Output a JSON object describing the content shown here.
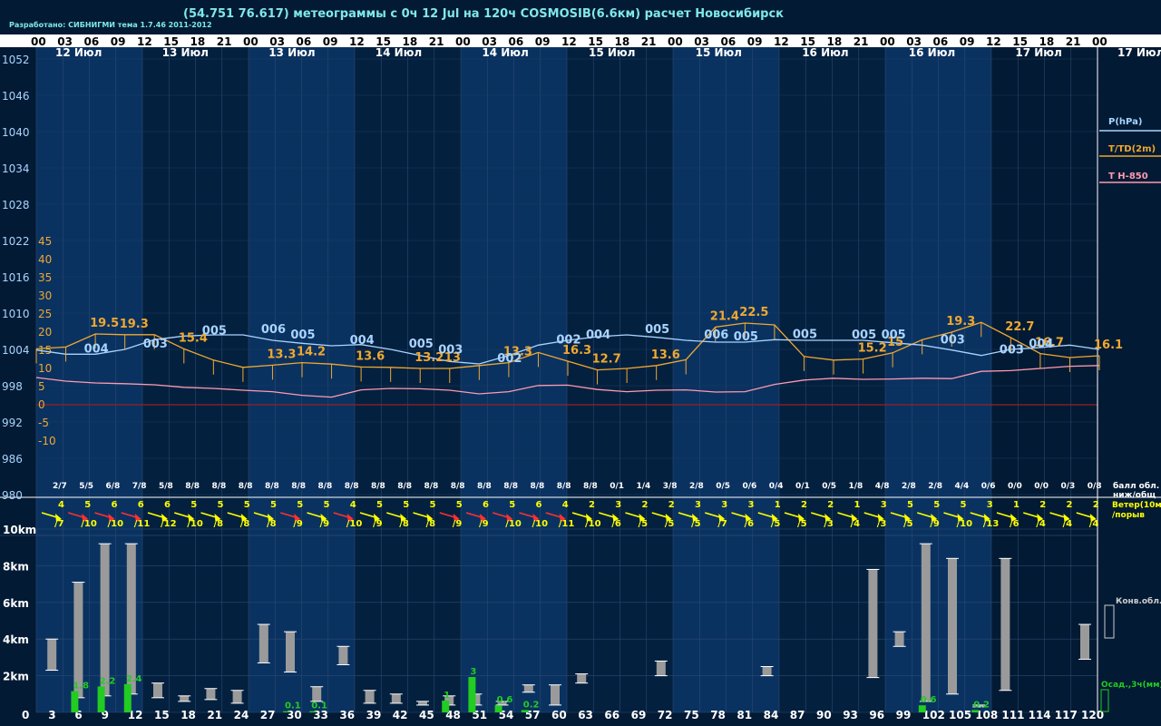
{
  "header": {
    "title": "(54.751 76.617) метеограммы с  0ч 12 Jul на 120ч COSMOSIB(6.6км) расчет Новосибирск",
    "credit": "Разработано: СИБНИГМИ тема 1.7.46 2011-2012"
  },
  "colors": {
    "background": "#021a34",
    "band_light": "#0a3261",
    "band_dark": "#04203f",
    "temperature": "#f0a830",
    "pressure": "#a9d4ff",
    "t850": "#ff9ab0",
    "precip": "#22cc22",
    "cloud_bar": "#9a9a9a",
    "wind_yellow": "#ffff00",
    "wind_red": "#ff3030",
    "zero_line": "#9a2020"
  },
  "chart_data": [
    {
      "type": "line",
      "hour_ticks": [
        "00",
        "03",
        "06",
        "09",
        "12",
        "15",
        "18",
        "21",
        "00",
        "03",
        "06",
        "09",
        "12",
        "15",
        "18",
        "21",
        "00",
        "03",
        "06",
        "09",
        "12",
        "15",
        "18",
        "21",
        "00",
        "03",
        "06",
        "09",
        "12",
        "15",
        "18",
        "21",
        "00",
        "03",
        "06",
        "09",
        "12",
        "15",
        "18",
        "21",
        "00"
      ],
      "day_labels": [
        "12 Июл",
        "13 Июл",
        "13 Июл",
        "14 Июл",
        "14 Июл",
        "15 Июл",
        "15 Июл",
        "16 Июл",
        "16 Июл",
        "17 Июл"
      ],
      "right_day_label": "17 Июл",
      "pressure_axis": [
        1052,
        1046,
        1040,
        1034,
        1028,
        1022,
        1016,
        1010,
        1004,
        998,
        992,
        986,
        980
      ],
      "temp_axis": [
        "45",
        "40",
        "35",
        "30",
        "25",
        "20",
        "15",
        "10",
        "5",
        "0",
        "-5",
        "-10"
      ],
      "legend": [
        "P(hPa)",
        "T/TD(2m)",
        "T H-850"
      ],
      "series": [
        {
          "name": "T/TD(2m)",
          "values": [
            15.4,
            15.9,
            19.5,
            19.3,
            19.3,
            15.4,
            12.3,
            10.3,
            10.9,
            11.6,
            11.2,
            10.4,
            10.3,
            10.0,
            10.0,
            10.8,
            11.6,
            14.4,
            12.0,
            9.6,
            10.0,
            10.8,
            12.4,
            21.4,
            22.5,
            22.0,
            13.3,
            12.3,
            12.6,
            14.3,
            17.9,
            20.0,
            22.7,
            18.5,
            14.1,
            13.0,
            13.5
          ]
        },
        {
          "name": "P(hPa)",
          "values": [
            1003.9,
            1003.2,
            1003.2,
            1004.0,
            1005.6,
            1006.2,
            1006.4,
            1006.4,
            1005.5,
            1005.0,
            1004.6,
            1004.8,
            1004.0,
            1003.0,
            1002.0,
            1001.6,
            1003.0,
            1004.7,
            1005.5,
            1006.1,
            1006.4,
            1006.0,
            1005.5,
            1005.2,
            1005.2,
            1005.6,
            1005.5,
            1005.5,
            1005.5,
            1005.1,
            1004.7,
            1003.9,
            1003.0,
            1004.0,
            1004.3,
            1004.7,
            1004.0
          ]
        },
        {
          "name": "T H-850",
          "values": [
            7.5,
            6.5,
            6.0,
            5.8,
            5.5,
            4.8,
            4.5,
            4.0,
            3.6,
            2.6,
            2.1,
            4.1,
            4.5,
            4.4,
            4.0,
            3.0,
            3.6,
            5.3,
            5.4,
            4.2,
            3.6,
            4.0,
            4.1,
            3.5,
            3.6,
            5.6,
            6.8,
            7.3,
            7.0,
            7.1,
            7.3,
            7.2,
            9.2,
            9.4,
            10.0,
            10.6,
            10.8
          ]
        }
      ],
      "temp_labels": [
        {
          "hour": 6,
          "text": "19.5"
        },
        {
          "hour": 12,
          "text": "19.3"
        },
        {
          "hour": 18,
          "text": "15.4"
        },
        {
          "hour": 27,
          "text": "13.3"
        },
        {
          "hour": 33,
          "text": "14.2"
        },
        {
          "hour": 39,
          "text": "13.6"
        },
        {
          "hour": 45,
          "text": "13.2"
        },
        {
          "hour": 51,
          "text": "13"
        },
        {
          "hour": 57,
          "text": "13.3"
        },
        {
          "hour": 63,
          "text": "16.3"
        },
        {
          "hour": 69,
          "text": "12.7"
        },
        {
          "hour": 75,
          "text": "13.6"
        },
        {
          "hour": 81,
          "text": "21.4"
        },
        {
          "hour": 87,
          "text": "22.5"
        },
        {
          "hour": 99,
          "text": "15.2"
        },
        {
          "hour": 105,
          "text": "15"
        },
        {
          "hour": 111,
          "text": "19.3"
        },
        {
          "hour": 117,
          "text": "22.7"
        },
        {
          "hour": 123,
          "text": "16.7"
        },
        {
          "hour": 129,
          "text": "16.1"
        }
      ],
      "pressure_labels": [
        {
          "hour": 3,
          "text": "004"
        },
        {
          "hour": 9,
          "text": "003"
        },
        {
          "hour": 18,
          "text": "005"
        },
        {
          "hour": 24,
          "text": "006"
        },
        {
          "hour": 30,
          "text": "005"
        },
        {
          "hour": 36,
          "text": "004"
        },
        {
          "hour": 42,
          "text": "005"
        },
        {
          "hour": 48,
          "text": "003"
        },
        {
          "hour": 54,
          "text": "002"
        },
        {
          "hour": 60,
          "text": "002"
        },
        {
          "hour": 66,
          "text": "004"
        },
        {
          "hour": 72,
          "text": "005"
        },
        {
          "hour": 78,
          "text": "006"
        },
        {
          "hour": 84,
          "text": "005"
        },
        {
          "hour": 90,
          "text": "005"
        },
        {
          "hour": 96,
          "text": "005"
        },
        {
          "hour": 102,
          "text": "005"
        },
        {
          "hour": 108,
          "text": "003"
        },
        {
          "hour": 114,
          "text": "003"
        },
        {
          "hour": 120,
          "text": "004"
        }
      ],
      "cloud_fractions": [
        "2/7",
        "5/5",
        "6/8",
        "7/8",
        "5/8",
        "8/8",
        "8/8",
        "8/8",
        "8/8",
        "8/8",
        "8/8",
        "8/8",
        "8/8",
        "8/8",
        "8/8",
        "8/8",
        "8/8",
        "8/8",
        "8/8",
        "8/8",
        "8/8",
        "0/1",
        "1/4",
        "3/8",
        "2/8",
        "0/5",
        "0/6",
        "0/4",
        "0/1",
        "0/5",
        "1/8",
        "4/8",
        "2/8",
        "2/8",
        "4/4",
        "0/6",
        "0/0",
        "0/0",
        "0/3",
        "0/8"
      ],
      "cloud_legend": [
        "балл обл.",
        "ниж/общ"
      ]
    },
    {
      "type": "wind",
      "wind_speed": [
        "4",
        "5",
        "6",
        "6",
        "6",
        "5",
        "5",
        "5",
        "5",
        "5",
        "5",
        "4",
        "5",
        "5",
        "5",
        "5",
        "6",
        "5",
        "6",
        "4",
        "2",
        "3",
        "2",
        "2",
        "3",
        "3",
        "3",
        "1",
        "2",
        "2",
        "1",
        "3",
        "5",
        "5",
        "5",
        "3",
        "1",
        "2",
        "2",
        "2"
      ],
      "wind_gust": [
        "/7",
        "/10",
        "/10",
        "/11",
        "/12",
        "/10",
        "/8",
        "/8",
        "/8",
        "/9",
        "/9",
        "/10",
        "/9",
        "/8",
        "/8",
        "/9",
        "/9",
        "/10",
        "/10",
        "/11",
        "/10",
        "/6",
        "/5",
        "/5",
        "/5",
        "/7",
        "/6",
        "/5",
        "/5",
        "/3",
        "/4",
        "/3",
        "/5",
        "/9",
        "/10",
        "/13",
        "/6",
        "/4",
        "/4",
        "/4"
      ],
      "wind_strong": [
        false,
        true,
        true,
        true,
        false,
        false,
        false,
        false,
        false,
        true,
        false,
        true,
        false,
        false,
        false,
        true,
        true,
        true,
        true,
        true,
        false,
        false,
        false,
        false,
        false,
        false,
        false,
        false,
        false,
        false,
        false,
        false,
        false,
        false,
        false,
        false,
        false,
        false,
        false,
        false
      ],
      "legend": [
        "Ветер(10м)",
        "/порыв"
      ]
    },
    {
      "type": "bar",
      "x_hours": [
        "0",
        "3",
        "6",
        "9",
        "12",
        "15",
        "18",
        "21",
        "24",
        "27",
        "30",
        "33",
        "36",
        "39",
        "42",
        "45",
        "48",
        "51",
        "54",
        "57",
        "60",
        "63",
        "66",
        "69",
        "72",
        "75",
        "78",
        "81",
        "84",
        "87",
        "90",
        "93",
        "96",
        "99",
        "102",
        "105",
        "108",
        "111",
        "114",
        "117",
        "120"
      ],
      "height_axis": [
        "10km",
        "8km",
        "6km",
        "4km",
        "2km"
      ],
      "cloud_bars": [
        [
          3,
          2.3,
          4.0
        ],
        [
          6,
          0.8,
          7.1
        ],
        [
          9,
          0.9,
          9.2
        ],
        [
          12,
          1.0,
          9.2
        ],
        [
          15,
          0.8,
          1.6
        ],
        [
          18,
          0.6,
          0.9
        ],
        [
          21,
          0.7,
          1.3
        ],
        [
          24,
          0.5,
          1.2
        ],
        [
          27,
          2.7,
          4.8
        ],
        [
          30,
          2.2,
          4.4
        ],
        [
          33,
          0.6,
          1.4
        ],
        [
          36,
          2.6,
          3.6
        ],
        [
          39,
          0.5,
          1.2
        ],
        [
          42,
          0.5,
          1.0
        ],
        [
          45,
          0.4,
          0.6
        ],
        [
          48,
          0.4,
          0.9
        ],
        [
          51,
          0.4,
          1.0
        ],
        [
          54,
          0.4,
          0.6
        ],
        [
          57,
          1.1,
          1.5
        ],
        [
          60,
          0.4,
          1.5
        ],
        [
          63,
          1.6,
          2.1
        ],
        [
          72,
          2.0,
          2.8
        ],
        [
          84,
          2.0,
          2.5
        ],
        [
          96,
          1.9,
          7.8
        ],
        [
          99,
          3.6,
          4.4
        ],
        [
          102,
          0.6,
          9.2
        ],
        [
          105,
          1.0,
          8.4
        ],
        [
          108,
          0.3,
          0.4
        ],
        [
          111,
          1.2,
          8.4
        ],
        [
          120,
          2.9,
          4.8
        ]
      ],
      "precip": [
        {
          "hour": 6,
          "value": 1.8,
          "label": "1.8"
        },
        {
          "hour": 9,
          "value": 2.2,
          "label": "2.2"
        },
        {
          "hour": 12,
          "value": 2.4,
          "label": "2.4"
        },
        {
          "hour": 30,
          "value": 0.1,
          "label": "0.1"
        },
        {
          "hour": 33,
          "value": 0.1,
          "label": "0.1"
        },
        {
          "hour": 48,
          "value": 1.0,
          "label": "1"
        },
        {
          "hour": 51,
          "value": 3.0,
          "label": "3"
        },
        {
          "hour": 54,
          "value": 0.6,
          "label": "0.6"
        },
        {
          "hour": 57,
          "value": 0.2,
          "label": "0.2"
        },
        {
          "hour": 102,
          "value": 0.6,
          "label": "0.6"
        },
        {
          "hour": 108,
          "value": 0.2,
          "label": "0.2"
        }
      ],
      "legend": [
        "Конв.обл.",
        "Осад.,3ч(мм)"
      ]
    }
  ]
}
